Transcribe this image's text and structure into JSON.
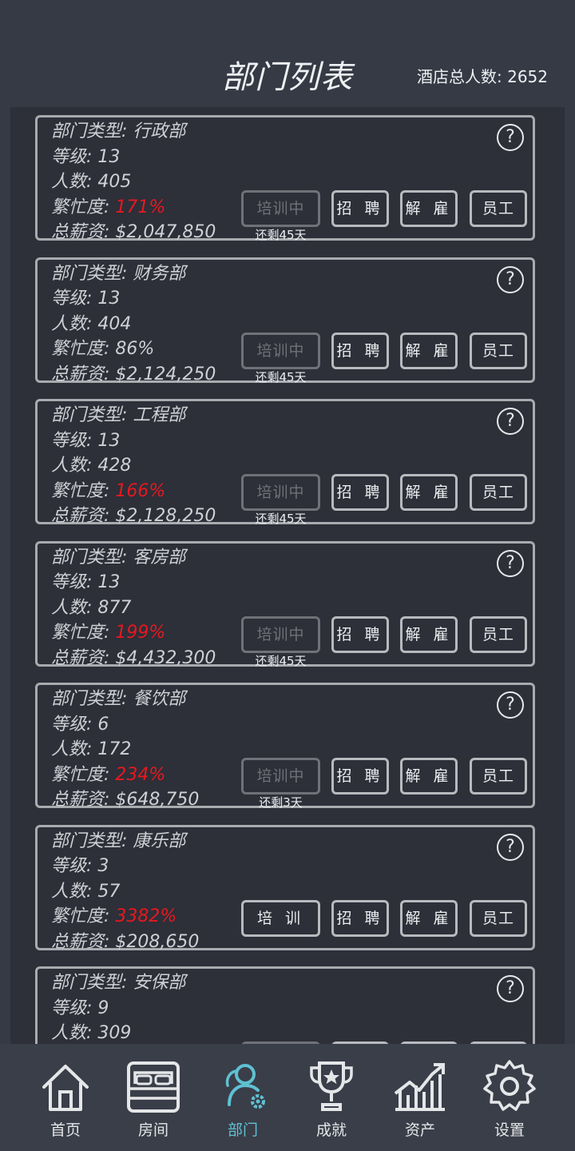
{
  "header": {
    "title": "部门列表",
    "total_label": "酒店总人数: 2652"
  },
  "labels": {
    "type": "部门类型: ",
    "level": "等级: ",
    "count": "人数: ",
    "busy": "繁忙度: ",
    "salary": "总薪资: ",
    "help": "?",
    "training": "培训中",
    "train": "培 训",
    "hire": "招 聘",
    "fire": "解 雇",
    "staff": "员工"
  },
  "departments": [
    {
      "type": "行政部",
      "level": "13",
      "count": "405",
      "busy": "171%",
      "busy_hot": true,
      "salary": "$2,047,850",
      "training": true,
      "remaining": "还剩45天"
    },
    {
      "type": "财务部",
      "level": "13",
      "count": "404",
      "busy": "86%",
      "busy_hot": false,
      "salary": "$2,124,250",
      "training": true,
      "remaining": "还剩45天"
    },
    {
      "type": "工程部",
      "level": "13",
      "count": "428",
      "busy": "166%",
      "busy_hot": true,
      "salary": "$2,128,250",
      "training": true,
      "remaining": "还剩45天"
    },
    {
      "type": "客房部",
      "level": "13",
      "count": "877",
      "busy": "199%",
      "busy_hot": true,
      "salary": "$4,432,300",
      "training": true,
      "remaining": "还剩45天"
    },
    {
      "type": "餐饮部",
      "level": "6",
      "count": "172",
      "busy": "234%",
      "busy_hot": true,
      "salary": "$648,750",
      "training": true,
      "remaining": "还剩3天"
    },
    {
      "type": "康乐部",
      "level": "3",
      "count": "57",
      "busy": "3382%",
      "busy_hot": true,
      "salary": "$208,650",
      "training": false,
      "remaining": ""
    },
    {
      "type": "安保部",
      "level": "9",
      "count": "309",
      "busy": "",
      "busy_hot": false,
      "salary": "",
      "training": true,
      "remaining": ""
    }
  ],
  "nav": [
    {
      "label": "首页",
      "icon": "home-icon",
      "active": false
    },
    {
      "label": "房间",
      "icon": "bed-icon",
      "active": false
    },
    {
      "label": "部门",
      "icon": "staff-settings-icon",
      "active": true
    },
    {
      "label": "成就",
      "icon": "trophy-icon",
      "active": false
    },
    {
      "label": "资产",
      "icon": "chart-icon",
      "active": false
    },
    {
      "label": "设置",
      "icon": "gear-icon",
      "active": false
    }
  ],
  "colors": {
    "background": "#363a45",
    "panel": "#2d2f39",
    "busy_hot": "#e5191f",
    "nav_active": "#5ec1d2"
  }
}
